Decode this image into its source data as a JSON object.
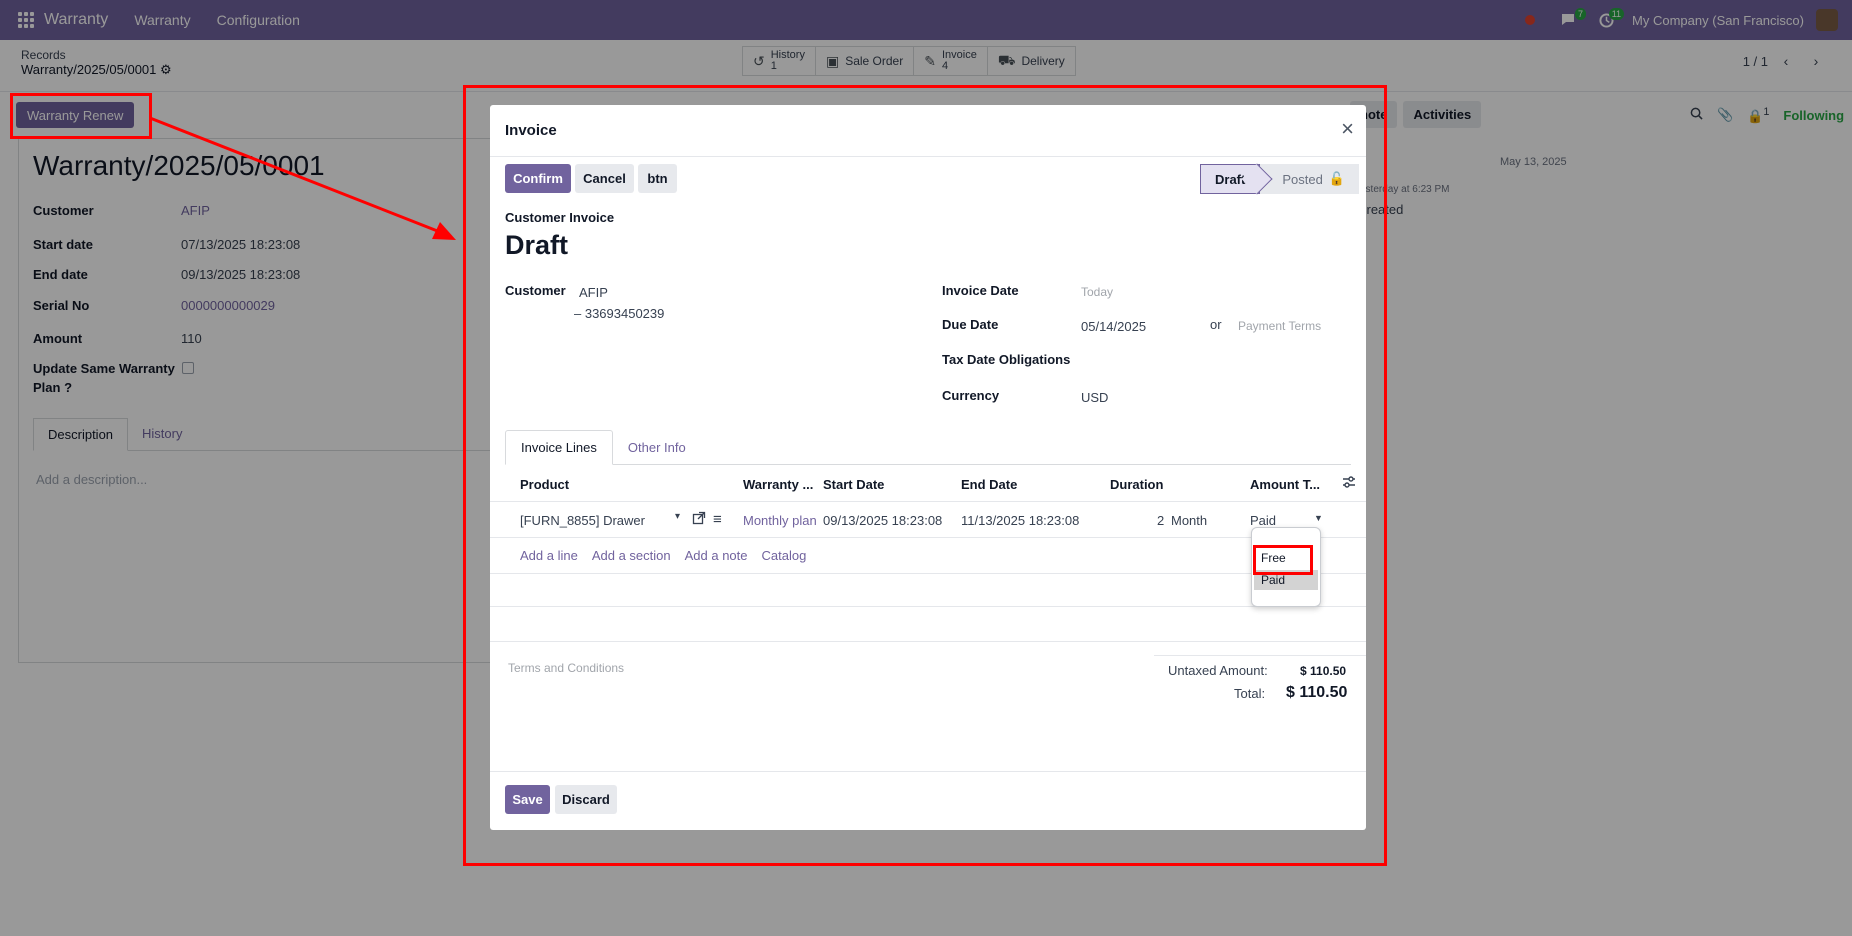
{
  "navbar": {
    "brand": "Warranty",
    "menu": [
      "Warranty",
      "Configuration"
    ],
    "chat_count": "7",
    "activity_count": "11",
    "company": "My Company (San Francisco)"
  },
  "breadcrumb": {
    "parent": "Records",
    "current": "Warranty/2025/05/0001"
  },
  "smart_buttons": [
    {
      "label": "History",
      "count": "1"
    },
    {
      "label": "Sale Order",
      "count": ""
    },
    {
      "label": "Invoice",
      "count": "4"
    },
    {
      "label": "Delivery",
      "count": ""
    }
  ],
  "pager": {
    "value": "1 / 1"
  },
  "record": {
    "renew_button": "Warranty Renew",
    "title": "Warranty/2025/05/0001",
    "fields": {
      "customer_label": "Customer",
      "customer": "AFIP",
      "start_label": "Start date",
      "start": "07/13/2025 18:23:08",
      "end_label": "End date",
      "end": "09/13/2025 18:23:08",
      "serial_label": "Serial No",
      "serial": "0000000000029",
      "amount_label": "Amount",
      "amount": "110",
      "update_label_1": "Update Same Warranty",
      "update_label_2": "Plan ?"
    },
    "tabs": [
      "Description",
      "History"
    ],
    "description_placeholder": "Add a description..."
  },
  "chatter": {
    "buttons": [
      "note",
      "Activities"
    ],
    "followers": "1",
    "following": "Following",
    "date": "May 13, 2025",
    "time": "esterday at 6:23 PM",
    "message": "created"
  },
  "modal": {
    "title": "Invoice",
    "close": "×",
    "buttons": {
      "confirm": "Confirm",
      "cancel": "Cancel",
      "btn": "btn"
    },
    "status": {
      "draft": "Draft",
      "posted": "Posted"
    },
    "invoice_type": "Customer Invoice",
    "invoice_name": "Draft",
    "customer_label": "Customer",
    "customer_name": "AFIP",
    "customer_vat": "– 33693450239",
    "invoice_date_label": "Invoice Date",
    "invoice_date_placeholder": "Today",
    "due_date_label": "Due Date",
    "due_date": "05/14/2025",
    "or": "or",
    "payment_terms_placeholder": "Payment Terms",
    "tax_date_label": "Tax Date Obligations",
    "currency_label": "Currency",
    "currency": "USD",
    "tabs": [
      "Invoice Lines",
      "Other Info"
    ],
    "columns": [
      "Product",
      "Warranty ...",
      "Start Date",
      "End Date",
      "Duration",
      "Amount T..."
    ],
    "line": {
      "product": "[FURN_8855] Drawer",
      "warranty": "Monthly plan",
      "start": "09/13/2025 18:23:08",
      "end": "11/13/2025 18:23:08",
      "duration_qty": "2",
      "duration_unit": "Month",
      "amount_type": "Paid"
    },
    "row_actions": [
      "Add a line",
      "Add a section",
      "Add a note",
      "Catalog"
    ],
    "terms_placeholder": "Terms and Conditions",
    "untaxed_label": "Untaxed Amount:",
    "untaxed": "$ 110.50",
    "total_label": "Total:",
    "total": "$ 110.50",
    "footer": {
      "save": "Save",
      "discard": "Discard"
    },
    "dropdown": {
      "options": [
        "Free",
        "Paid"
      ],
      "selected": "Paid"
    }
  },
  "colors": {
    "brand": "#71639e",
    "annotation": "#ff0000",
    "following": "#28a745"
  }
}
